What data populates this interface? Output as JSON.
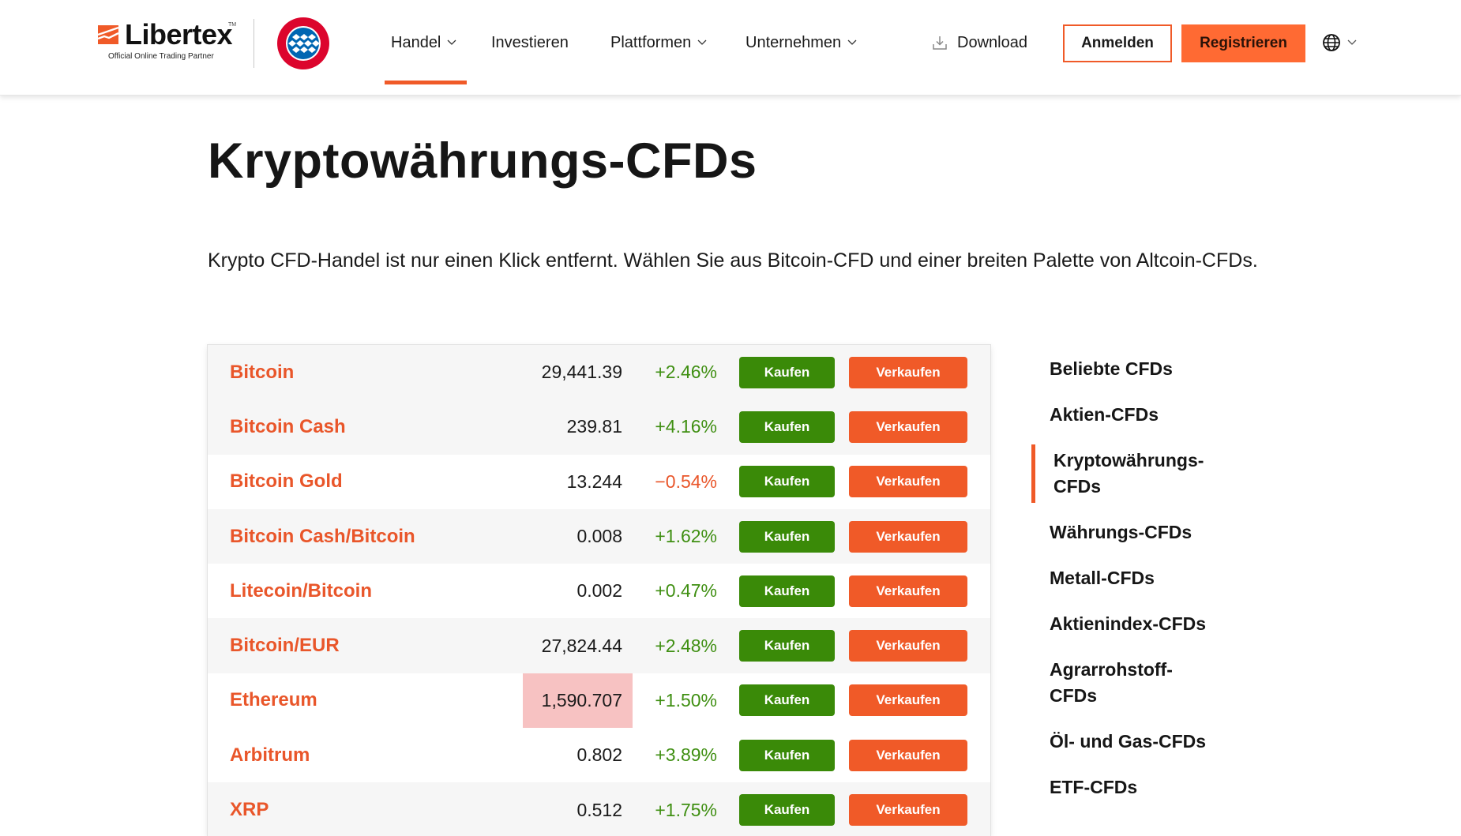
{
  "header": {
    "brand": "Libertex",
    "brand_tm": "TM",
    "brand_tagline": "Official Online Trading Partner",
    "partner_logo": "fc-bayern-muenchen-logo",
    "nav": [
      {
        "label": "Handel",
        "has_dropdown": true,
        "active": true
      },
      {
        "label": "Investieren",
        "has_dropdown": false,
        "active": false
      },
      {
        "label": "Plattformen",
        "has_dropdown": true,
        "active": false
      },
      {
        "label": "Unternehmen",
        "has_dropdown": true,
        "active": false
      }
    ],
    "download_label": "Download",
    "login_label": "Anmelden",
    "register_label": "Registrieren",
    "language_icon": "globe-icon"
  },
  "main": {
    "title": "Kryptowährungs-CFDs",
    "intro": "Krypto CFD-Handel ist nur einen Klick entfernt. Wählen Sie aus Bitcoin-CFD und einer breiten Palette von Altcoin-CFDs.",
    "buy_label": "Kaufen",
    "sell_label": "Verkaufen",
    "instruments": [
      {
        "name": "Bitcoin",
        "price": "29,441.39",
        "change": "+2.46%",
        "direction": "up"
      },
      {
        "name": "Bitcoin Cash",
        "price": "239.81",
        "change": "+4.16%",
        "direction": "up"
      },
      {
        "name": "Bitcoin Gold",
        "price": "13.244",
        "change": "−0.54%",
        "direction": "down"
      },
      {
        "name": "Bitcoin Cash/Bitcoin",
        "price": "0.008",
        "change": "+1.62%",
        "direction": "up"
      },
      {
        "name": "Litecoin/Bitcoin",
        "price": "0.002",
        "change": "+0.47%",
        "direction": "up"
      },
      {
        "name": "Bitcoin/EUR",
        "price": "27,824.44",
        "change": "+2.48%",
        "direction": "up"
      },
      {
        "name": "Ethereum",
        "price": "1,590.707",
        "change": "+1.50%",
        "direction": "up",
        "price_flash": "down"
      },
      {
        "name": "Arbitrum",
        "price": "0.802",
        "change": "+3.89%",
        "direction": "up"
      },
      {
        "name": "XRP",
        "price": "0.512",
        "change": "+1.75%",
        "direction": "up"
      }
    ]
  },
  "sidebar": {
    "items": [
      {
        "label": "Beliebte CFDs",
        "active": false
      },
      {
        "label": "Aktien-CFDs",
        "active": false
      },
      {
        "label": "Kryptowährungs-CFDs",
        "active": true
      },
      {
        "label": "Währungs-CFDs",
        "active": false
      },
      {
        "label": "Metall-CFDs",
        "active": false
      },
      {
        "label": "Aktienindex-CFDs",
        "active": false
      },
      {
        "label": "Agrarrohstoff-CFDs",
        "active": false
      },
      {
        "label": "Öl- und Gas-CFDs",
        "active": false
      },
      {
        "label": "ETF-CFDs",
        "active": false
      }
    ]
  },
  "colors": {
    "brand_orange": "#f05a28",
    "register_bg": "#ff6a33",
    "buy_green": "#3a8a08",
    "positive": "#3f8f12",
    "negative": "#e9562a",
    "price_flash_bg": "#f7c2c2"
  }
}
